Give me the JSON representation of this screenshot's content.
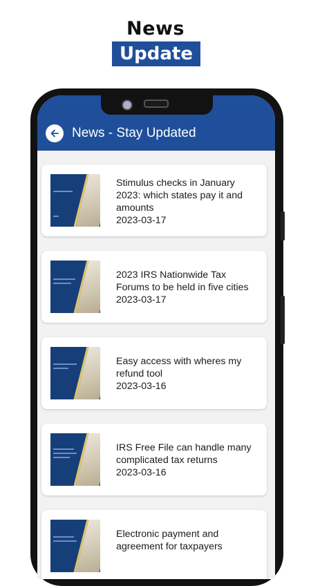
{
  "promo": {
    "title": "News",
    "badge": "Update"
  },
  "colors": {
    "brand_blue": "#1f4f9a",
    "thumbnail_navy": "#163f7a",
    "card_background": "#ffffff",
    "list_background": "#f2f2f2"
  },
  "app_bar": {
    "back_icon": "arrow-left-icon",
    "title": "News - Stay Updated"
  },
  "news": [
    {
      "title": "Stimulus checks in January 2023: which states pay it and amounts",
      "date": "2023-03-17"
    },
    {
      "title": "2023 IRS Nationwide Tax Forums to be held in five cities",
      "date": "2023-03-17"
    },
    {
      "title": "Easy access with wheres my refund tool",
      "date": "2023-03-16"
    },
    {
      "title": "IRS Free File can handle many complicated tax returns",
      "date": "2023-03-16"
    },
    {
      "title": "Electronic payment and agreement for taxpayers",
      "date": ""
    }
  ]
}
